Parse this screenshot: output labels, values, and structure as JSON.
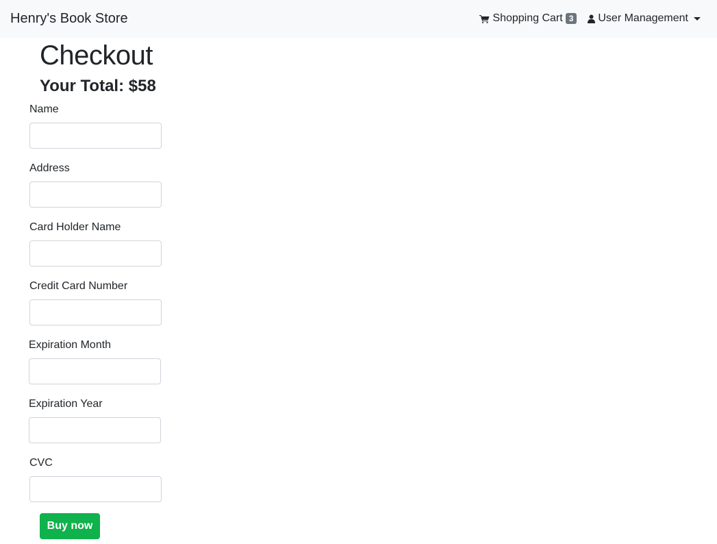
{
  "navbar": {
    "brand": "Henry's Book Store",
    "cart": {
      "label": "Shopping Cart",
      "count": "3",
      "icon": "shopping-cart-icon"
    },
    "user_menu": {
      "label": "User Management",
      "icon": "user-icon"
    }
  },
  "checkout": {
    "title": "Checkout",
    "total": "Your Total: $58",
    "fields": [
      {
        "label": "Name",
        "value": ""
      },
      {
        "label": "Address",
        "value": ""
      },
      {
        "label": "Card Holder Name",
        "value": ""
      },
      {
        "label": "Credit Card Number",
        "value": ""
      },
      {
        "label": "Expiration Month",
        "value": ""
      },
      {
        "label": "Expiration Year",
        "value": ""
      },
      {
        "label": "CVC",
        "value": ""
      }
    ],
    "buy_label": "Buy now"
  },
  "colors": {
    "navbar_bg": "#f8f9fa",
    "buy_button": "#0fb24c",
    "badge": "#6c757d"
  }
}
